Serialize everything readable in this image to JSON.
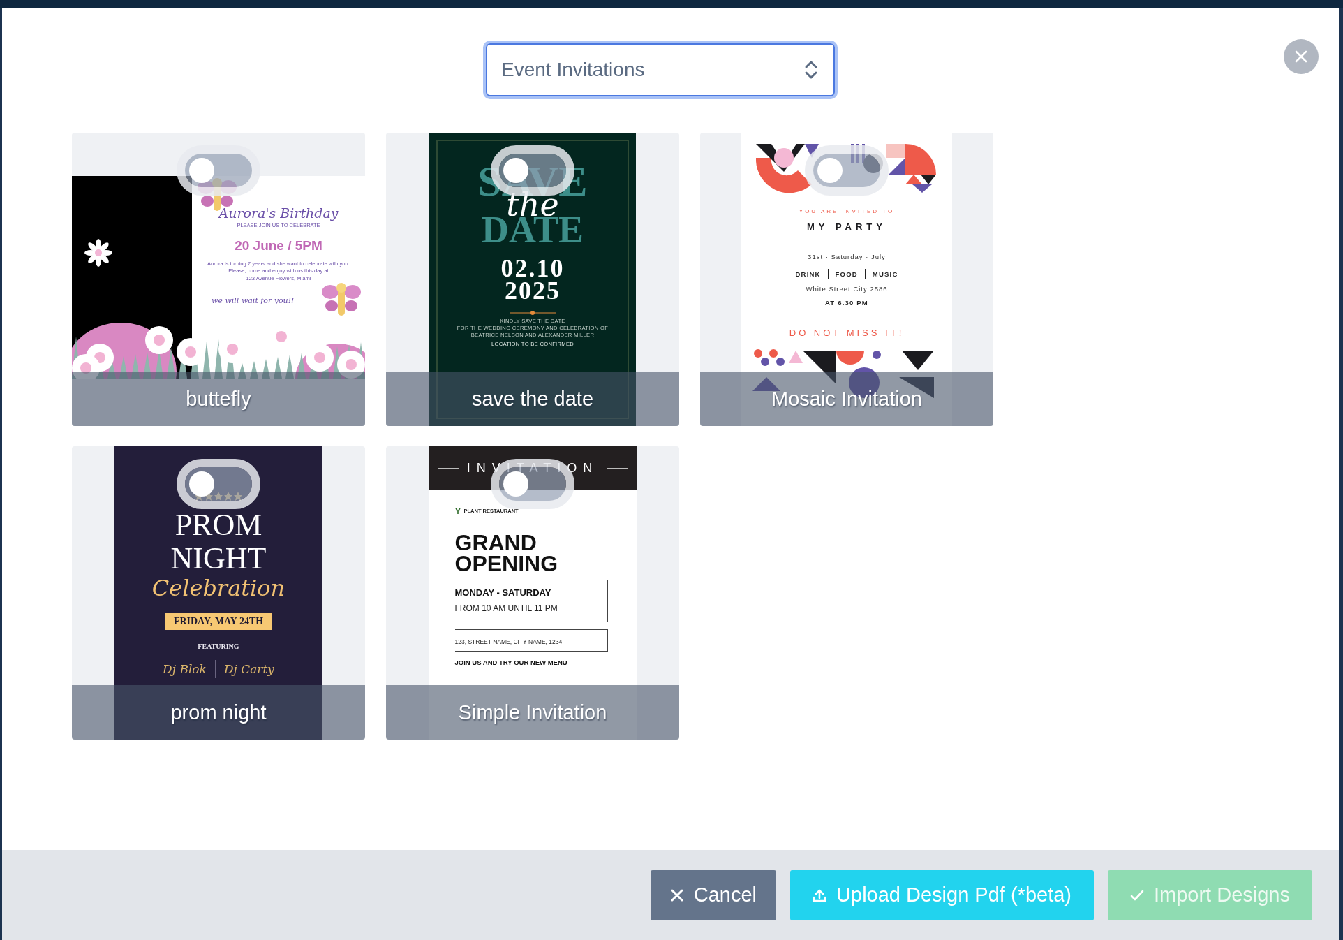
{
  "category_select": {
    "value": "Event Invitations"
  },
  "designs": [
    {
      "name": "buttefly",
      "selected": false,
      "preview": {
        "kind": "birthday",
        "title": "Aurora's Birthday",
        "subtitle": "PLEASE JOIN US TO CELEBRATE",
        "date": "20 June / 5PM",
        "details": [
          "Aurora is turning 7 years and she want to celebrate with you.",
          "Please, come and enjoy with us this day at",
          "123 Avenue Flowers, Miami"
        ],
        "closing": "we will wait for you!!"
      }
    },
    {
      "name": "save the date",
      "selected": false,
      "preview": {
        "kind": "save_the_date",
        "heading": [
          "SAVE",
          "the",
          "DATE"
        ],
        "date": [
          "02.10",
          "2025"
        ],
        "details": [
          "KINDLY SAVE THE DATE",
          "FOR THE WEDDING CEREMONY AND CELEBRATION OF",
          "BEATRICE NELSON AND ALEXANDER MILLER"
        ],
        "location": "LOCATION TO BE CONFIRMED"
      }
    },
    {
      "name": "Mosaic Invitation",
      "selected": false,
      "preview": {
        "kind": "party",
        "intro": "YOU ARE INVITED TO",
        "title": "MY PARTY",
        "date": "31st · Saturday · July",
        "features": [
          "DRINK",
          "FOOD",
          "MUSIC"
        ],
        "address": "White Street City 2586",
        "time": "AT 6.30 PM",
        "closing": "DO NOT MISS IT!"
      }
    },
    {
      "name": "prom night",
      "selected": false,
      "preview": {
        "kind": "prom",
        "title": [
          "PROM",
          "NIGHT"
        ],
        "script": "Celebration",
        "date": "FRIDAY, MAY 24TH",
        "featuring": "FEATURING",
        "performers": [
          "Dj Blok",
          "Dj Carty"
        ]
      }
    },
    {
      "name": "Simple Invitation",
      "selected": false,
      "preview": {
        "kind": "opening",
        "banner": "INVITATION",
        "venue": "PLANT RESTAURANT",
        "title": [
          "GRAND",
          "OPENING"
        ],
        "days": "MONDAY - SATURDAY",
        "hours": "FROM 10 AM UNTIL 11 PM",
        "address": "123, STREET NAME, CITY NAME, 1234",
        "closing": "JOIN US AND TRY OUR NEW MENU"
      }
    }
  ],
  "buttons": [
    {
      "kind": "cancel",
      "label": "Cancel",
      "disabled": false
    },
    {
      "kind": "upload",
      "label": "Upload Design Pdf (*beta)",
      "disabled": false
    },
    {
      "kind": "import",
      "label": "Import Designs",
      "disabled": true
    }
  ]
}
